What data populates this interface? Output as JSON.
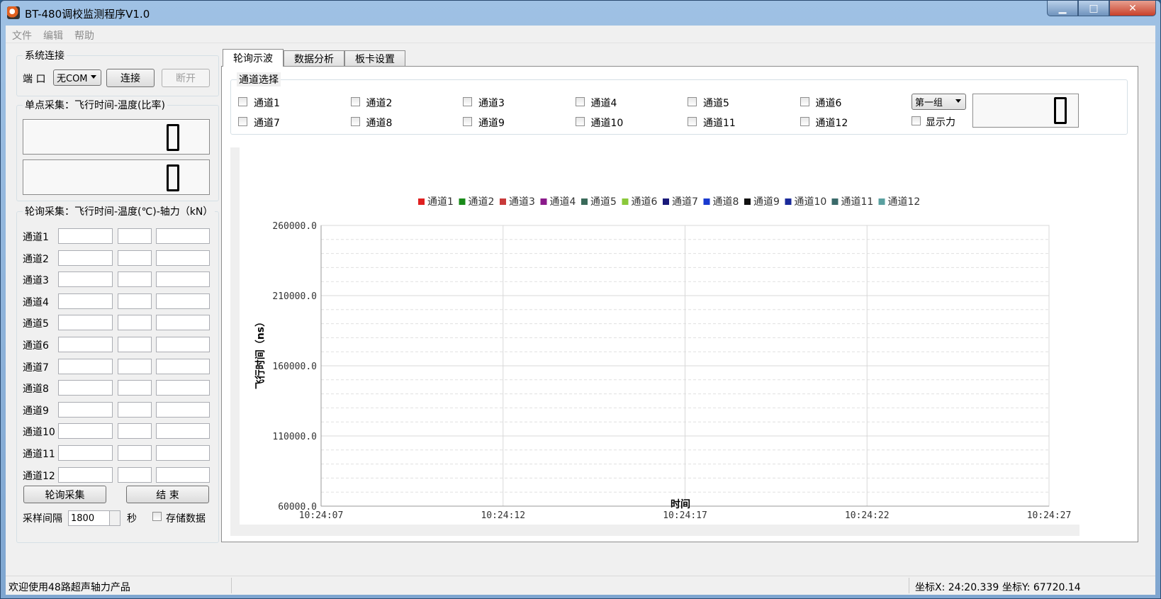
{
  "window": {
    "title": "BT-480调校监测程序V1.0",
    "minimize": "▁",
    "maximize": "□",
    "close": "✕"
  },
  "menu": {
    "file": "文件",
    "edit": "编辑",
    "help": "帮助"
  },
  "system_connect": {
    "title": "系统连接",
    "port_label": "端 口",
    "port_value": "无COM",
    "connect": "连接",
    "disconnect": "断开"
  },
  "single_sample": {
    "title": "单点采集：飞行时间-温度(比率)",
    "value1": "0",
    "value2": "0"
  },
  "poll_sample": {
    "title": "轮询采集：飞行时间-温度(℃)-轴力（kN）",
    "channels": [
      "通道1",
      "通道2",
      "通道3",
      "通道4",
      "通道5",
      "通道6",
      "通道7",
      "通道8",
      "通道9",
      "通道10",
      "通道11",
      "通道12"
    ],
    "start": "轮询采集",
    "stop": "结 束",
    "interval_label": "采样间隔",
    "interval_value": "1800",
    "interval_unit": "秒",
    "save_data": "存储数据"
  },
  "tabs": [
    "轮询示波",
    "数据分析",
    "板卡设置"
  ],
  "channel_select": {
    "title": "通道选择",
    "channels": [
      "通道1",
      "通道2",
      "通道3",
      "通道4",
      "通道5",
      "通道6",
      "通道7",
      "通道8",
      "通道9",
      "通道10",
      "通道11",
      "通道12"
    ],
    "group_value": "第一组",
    "show_force": "显示力",
    "display_value": "0"
  },
  "chart_data": {
    "type": "line",
    "xlabel": "时间",
    "ylabel": "飞行时间（ns）",
    "ylim": [
      60000,
      260000
    ],
    "y_ticks": [
      "60000.0",
      "110000.0",
      "160000.0",
      "210000.0",
      "260000.0"
    ],
    "x_ticks": [
      "10:24:07",
      "10:24:12",
      "10:24:17",
      "10:24:22",
      "10:24:27"
    ],
    "grid": true,
    "legend_position": "top",
    "series": [
      {
        "name": "通道1",
        "color": "#e02020",
        "values": []
      },
      {
        "name": "通道2",
        "color": "#1a8a1a",
        "values": []
      },
      {
        "name": "通道3",
        "color": "#c83a3a",
        "values": []
      },
      {
        "name": "通道4",
        "color": "#8a1a8a",
        "values": []
      },
      {
        "name": "通道5",
        "color": "#3a6a5a",
        "values": []
      },
      {
        "name": "通道6",
        "color": "#8ac83a",
        "values": []
      },
      {
        "name": "通道7",
        "color": "#1a1a7a",
        "values": []
      },
      {
        "name": "通道8",
        "color": "#1a3acf",
        "values": []
      },
      {
        "name": "通道9",
        "color": "#111111",
        "values": []
      },
      {
        "name": "通道10",
        "color": "#1a2a9a",
        "values": []
      },
      {
        "name": "通道11",
        "color": "#3a6a6a",
        "values": []
      },
      {
        "name": "通道12",
        "color": "#5aa0a0",
        "values": []
      }
    ]
  },
  "status": {
    "welcome": "欢迎使用48路超声轴力产品",
    "coord_x": "坐标X: 24:20.339",
    "coord_y": "坐标Y: 67720.14"
  }
}
